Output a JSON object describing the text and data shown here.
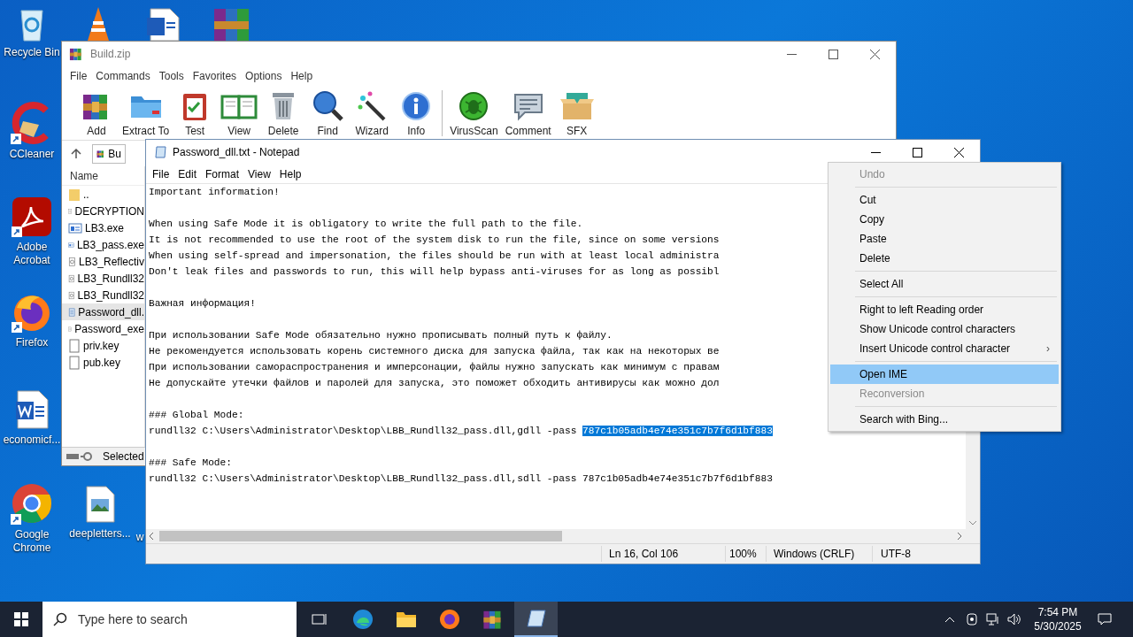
{
  "desktop_icons": [
    {
      "label": "Recycle Bin",
      "kind": "recycle",
      "shortcut": false
    },
    {
      "label": "CCleaner",
      "kind": "ccleaner",
      "shortcut": true
    },
    {
      "label": "Adobe Acrobat",
      "kind": "acrobat",
      "shortcut": true
    },
    {
      "label": "Firefox",
      "kind": "firefox",
      "shortcut": true
    },
    {
      "label": "economicf...",
      "kind": "word",
      "shortcut": false
    },
    {
      "label": "Google Chrome",
      "kind": "chrome",
      "shortcut": true
    },
    {
      "label": "deepletters...",
      "kind": "image",
      "shortcut": false
    },
    {
      "label": "w",
      "kind": "partial"
    }
  ],
  "winrar": {
    "title": "Build.zip",
    "menu": [
      "File",
      "Commands",
      "Tools",
      "Favorites",
      "Options",
      "Help"
    ],
    "toolbar": [
      {
        "kind": "button",
        "label": "Add"
      },
      {
        "kind": "button",
        "label": "Extract To"
      },
      {
        "kind": "button",
        "label": "Test"
      },
      {
        "kind": "button",
        "label": "View"
      },
      {
        "kind": "button",
        "label": "Delete"
      },
      {
        "kind": "button",
        "label": "Find"
      },
      {
        "kind": "button",
        "label": "Wizard"
      },
      {
        "kind": "button",
        "label": "Info"
      },
      {
        "kind": "separator"
      },
      {
        "kind": "button",
        "label": "VirusScan"
      },
      {
        "kind": "button",
        "label": "Comment"
      },
      {
        "kind": "button",
        "label": "SFX"
      }
    ],
    "address": "Bu",
    "list_header": "Name",
    "files": [
      {
        "name": "..",
        "kind": "folder",
        "selected": false
      },
      {
        "name": "DECRYPTION",
        "kind": "text",
        "selected": false
      },
      {
        "name": "LB3.exe",
        "kind": "exe",
        "selected": false
      },
      {
        "name": "LB3_pass.exe",
        "kind": "exe",
        "selected": false
      },
      {
        "name": "LB3_Reflectiv",
        "kind": "dll",
        "selected": false
      },
      {
        "name": "LB3_Rundll32",
        "kind": "dll",
        "selected": false
      },
      {
        "name": "LB3_Rundll32",
        "kind": "dll",
        "selected": false
      },
      {
        "name": "Password_dll.",
        "kind": "notepad",
        "selected": true
      },
      {
        "name": "Password_exe",
        "kind": "text",
        "selected": false
      },
      {
        "name": "priv.key",
        "kind": "blank",
        "selected": false
      },
      {
        "name": "pub.key",
        "kind": "blank",
        "selected": false
      }
    ],
    "status": "Selected"
  },
  "notepad": {
    "title": "Password_dll.txt - Notepad",
    "menu": [
      "File",
      "Edit",
      "Format",
      "View",
      "Help"
    ],
    "lines": [
      {
        "kind": "text",
        "text": "Important information!"
      },
      {
        "kind": "blank"
      },
      {
        "kind": "text",
        "text": "When using Safe Mode it is obligatory to write the full path to the file."
      },
      {
        "kind": "text",
        "text": "It is not recommended to use the root of the system disk to run the file, since on some versions"
      },
      {
        "kind": "text",
        "text": "When using self-spread and impersonation, the files should be run with at least local administra"
      },
      {
        "kind": "text",
        "text": "Don't leak files and passwords to run, this will help bypass anti-viruses for as long as possibl"
      },
      {
        "kind": "blank"
      },
      {
        "kind": "text",
        "text": "Важная информация!"
      },
      {
        "kind": "blank"
      },
      {
        "kind": "text",
        "text": "При использовании Safe Mode обязательно нужно прописывать полный путь к файлу."
      },
      {
        "kind": "text",
        "text": "Не рекомендуется использовать корень системного диска для запуска файла, так как на некоторых ве"
      },
      {
        "kind": "text",
        "text": "При использовании самораспространения и имперсонации, файлы нужно запускать как минимум с правам"
      },
      {
        "kind": "text",
        "text": "Не допускайте утечки файлов и паролей для запуска, это поможет обходить антивирусы как можно дол"
      },
      {
        "kind": "blank"
      },
      {
        "kind": "text",
        "text": "### Global Mode:"
      },
      {
        "kind": "text",
        "text": "rundll32 C:\\Users\\Administrator\\Desktop\\LBB_Rundll32_pass.dll,gdll -pass ",
        "selection": "787c1b05adb4e74e351c7b7f6d1bf883"
      },
      {
        "kind": "blank"
      },
      {
        "kind": "text",
        "text": "### Safe Mode:"
      },
      {
        "kind": "text",
        "text": "rundll32 C:\\Users\\Administrator\\Desktop\\LBB_Rundll32_pass.dll,sdll -pass 787c1b05adb4e74e351c7b7f6d1bf883"
      }
    ],
    "status": {
      "position": "Ln 16, Col 106",
      "zoom": "100%",
      "line_ending": "Windows (CRLF)",
      "encoding": "UTF-8"
    }
  },
  "context_menu": [
    {
      "kind": "item",
      "label": "Undo",
      "disabled": true,
      "selected": false
    },
    {
      "kind": "separator"
    },
    {
      "kind": "item",
      "label": "Cut",
      "disabled": false,
      "selected": false
    },
    {
      "kind": "item",
      "label": "Copy",
      "disabled": false,
      "selected": false
    },
    {
      "kind": "item",
      "label": "Paste",
      "disabled": false,
      "selected": false
    },
    {
      "kind": "item",
      "label": "Delete",
      "disabled": false,
      "selected": false
    },
    {
      "kind": "separator"
    },
    {
      "kind": "item",
      "label": "Select All",
      "disabled": false,
      "selected": false
    },
    {
      "kind": "separator"
    },
    {
      "kind": "item",
      "label": "Right to left Reading order",
      "disabled": false,
      "selected": false
    },
    {
      "kind": "item",
      "label": "Show Unicode control characters",
      "disabled": false,
      "selected": false
    },
    {
      "kind": "item",
      "label": "Insert Unicode control character",
      "disabled": false,
      "selected": false,
      "submenu": "›"
    },
    {
      "kind": "separator"
    },
    {
      "kind": "item",
      "label": "Open IME",
      "disabled": false,
      "selected": true
    },
    {
      "kind": "item",
      "label": "Reconversion",
      "disabled": true,
      "selected": false
    },
    {
      "kind": "separator"
    },
    {
      "kind": "item",
      "label": "Search with Bing...",
      "disabled": false,
      "selected": false
    }
  ],
  "taskbar": {
    "search_placeholder": "Type here to search",
    "apps": [
      {
        "kind": "taskview",
        "active": false
      },
      {
        "kind": "edge",
        "active": false
      },
      {
        "kind": "explorer",
        "active": false
      },
      {
        "kind": "firefox",
        "active": false
      },
      {
        "kind": "winrar",
        "active": false
      },
      {
        "kind": "notepad",
        "active": true
      }
    ],
    "time": "7:54 PM",
    "date": "5/30/2025"
  }
}
